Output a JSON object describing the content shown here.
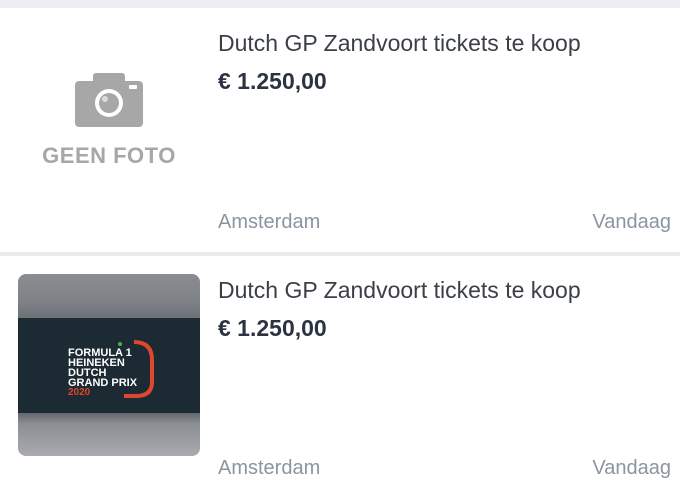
{
  "listings": [
    {
      "title": "Dutch GP Zandvoort tickets te koop",
      "price": "€ 1.250,00",
      "location": "Amsterdam",
      "date": "Vandaag",
      "image": {
        "type": "placeholder",
        "icon": "camera-icon",
        "text": "GEEN FOTO"
      }
    },
    {
      "title": "Dutch GP Zandvoort tickets te koop",
      "price": "€ 1.250,00",
      "location": "Amsterdam",
      "date": "Vandaag",
      "image": {
        "type": "photo",
        "lines": [
          "FORMULA 1",
          "HEINEKEN",
          "DUTCH",
          "GRAND PRIX",
          "2020"
        ]
      }
    }
  ],
  "colors": {
    "background": "#e9ebee",
    "card": "#ffffff",
    "title": "#3a3f48",
    "price": "#2b3340",
    "meta": "#8b95a1",
    "placeholder": "#a7a7a7",
    "f1_red": "#e0462b"
  }
}
